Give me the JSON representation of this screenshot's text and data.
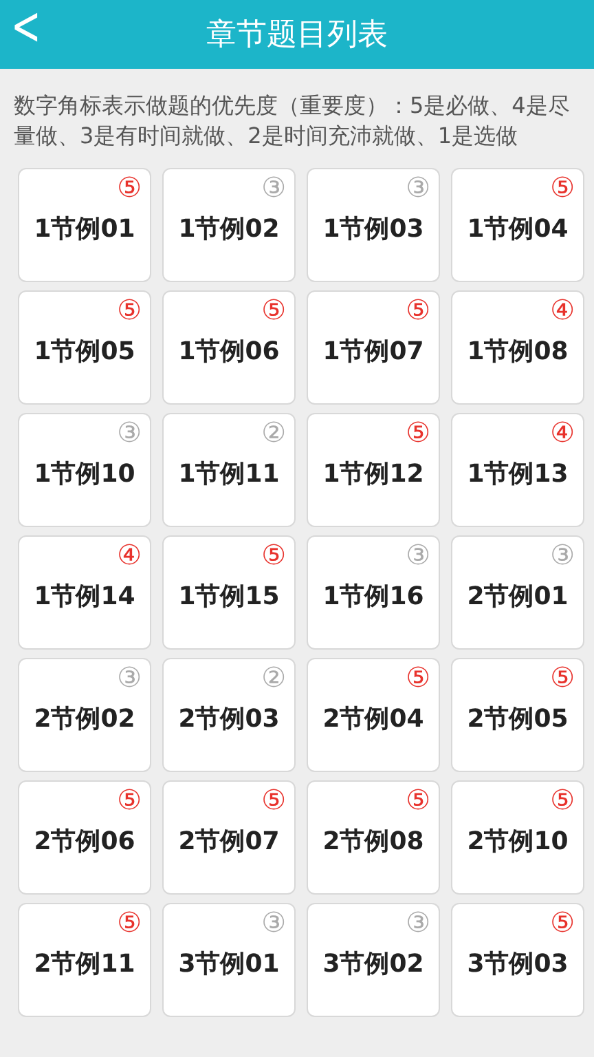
{
  "header": {
    "back": "<",
    "title": "章节题目列表"
  },
  "notice": "数字角标表示做题的优先度（重要度）：5是必做、4是尽量做、3是有时间就做、2是时间充沛就做、1是选做",
  "items": [
    {
      "label": "1节例01",
      "badge": "⑤",
      "color": "#e8322c"
    },
    {
      "label": "1节例02",
      "badge": "③",
      "color": "#aaaaaa"
    },
    {
      "label": "1节例03",
      "badge": "③",
      "color": "#aaaaaa"
    },
    {
      "label": "1节例04",
      "badge": "⑤",
      "color": "#e8322c"
    },
    {
      "label": "1节例05",
      "badge": "⑤",
      "color": "#e8322c"
    },
    {
      "label": "1节例06",
      "badge": "⑤",
      "color": "#e8322c"
    },
    {
      "label": "1节例07",
      "badge": "⑤",
      "color": "#e8322c"
    },
    {
      "label": "1节例08",
      "badge": "④",
      "color": "#e8322c"
    },
    {
      "label": "1节例10",
      "badge": "③",
      "color": "#aaaaaa"
    },
    {
      "label": "1节例11",
      "badge": "②",
      "color": "#aaaaaa"
    },
    {
      "label": "1节例12",
      "badge": "⑤",
      "color": "#e8322c"
    },
    {
      "label": "1节例13",
      "badge": "④",
      "color": "#e8322c"
    },
    {
      "label": "1节例14",
      "badge": "④",
      "color": "#e8322c"
    },
    {
      "label": "1节例15",
      "badge": "⑤",
      "color": "#e8322c"
    },
    {
      "label": "1节例16",
      "badge": "③",
      "color": "#aaaaaa"
    },
    {
      "label": "2节例01",
      "badge": "③",
      "color": "#aaaaaa"
    },
    {
      "label": "2节例02",
      "badge": "③",
      "color": "#aaaaaa"
    },
    {
      "label": "2节例03",
      "badge": "②",
      "color": "#aaaaaa"
    },
    {
      "label": "2节例04",
      "badge": "⑤",
      "color": "#e8322c"
    },
    {
      "label": "2节例05",
      "badge": "⑤",
      "color": "#e8322c"
    },
    {
      "label": "2节例06",
      "badge": "⑤",
      "color": "#e8322c"
    },
    {
      "label": "2节例07",
      "badge": "⑤",
      "color": "#e8322c"
    },
    {
      "label": "2节例08",
      "badge": "⑤",
      "color": "#e8322c"
    },
    {
      "label": "2节例10",
      "badge": "⑤",
      "color": "#e8322c"
    },
    {
      "label": "2节例11",
      "badge": "⑤",
      "color": "#e8322c"
    },
    {
      "label": "3节例01",
      "badge": "③",
      "color": "#aaaaaa"
    },
    {
      "label": "3节例02",
      "badge": "③",
      "color": "#aaaaaa"
    },
    {
      "label": "3节例03",
      "badge": "⑤",
      "color": "#e8322c"
    }
  ]
}
